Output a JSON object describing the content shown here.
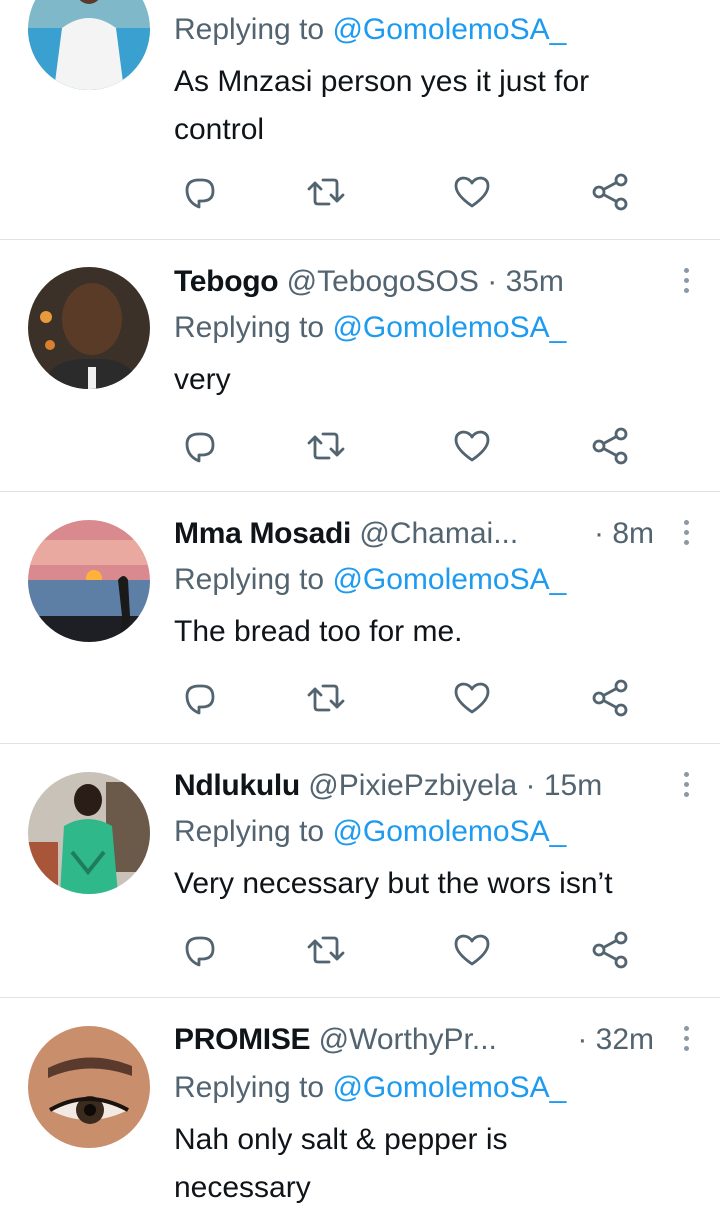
{
  "reply_prefix": "Replying to ",
  "replying_to": "@GomolemoSA_",
  "tweets": [
    {
      "name": "",
      "handle": "",
      "time": "",
      "text_lines": [
        "As Mnzasi person yes it just for",
        "control"
      ]
    },
    {
      "name": "Tebogo",
      "handle": "@TebogoSOS",
      "time": "35m",
      "text_lines": [
        "very"
      ]
    },
    {
      "name": "Mma Mosadi",
      "handle": "@Chamai...",
      "time": "8m",
      "text_lines": [
        "The bread too for me."
      ]
    },
    {
      "name": "Ndlukulu",
      "handle": "@PixiePzbiyela",
      "time": "15m",
      "text_lines": [
        "Very necessary but the wors isn’t"
      ]
    },
    {
      "name": "PROMISE",
      "handle": "@WorthyPr...",
      "time": "32m",
      "text_lines": [
        "Nah only salt & pepper is",
        "necessary"
      ]
    }
  ],
  "icons": {
    "reply": "speech-bubble-icon",
    "retweet": "retweet-icon",
    "like": "heart-icon",
    "share": "share-icon",
    "more": "more-vertical-icon"
  },
  "colors": {
    "link": "#1d9bf0",
    "secondary": "#536471",
    "divider": "#dfe3e7"
  }
}
